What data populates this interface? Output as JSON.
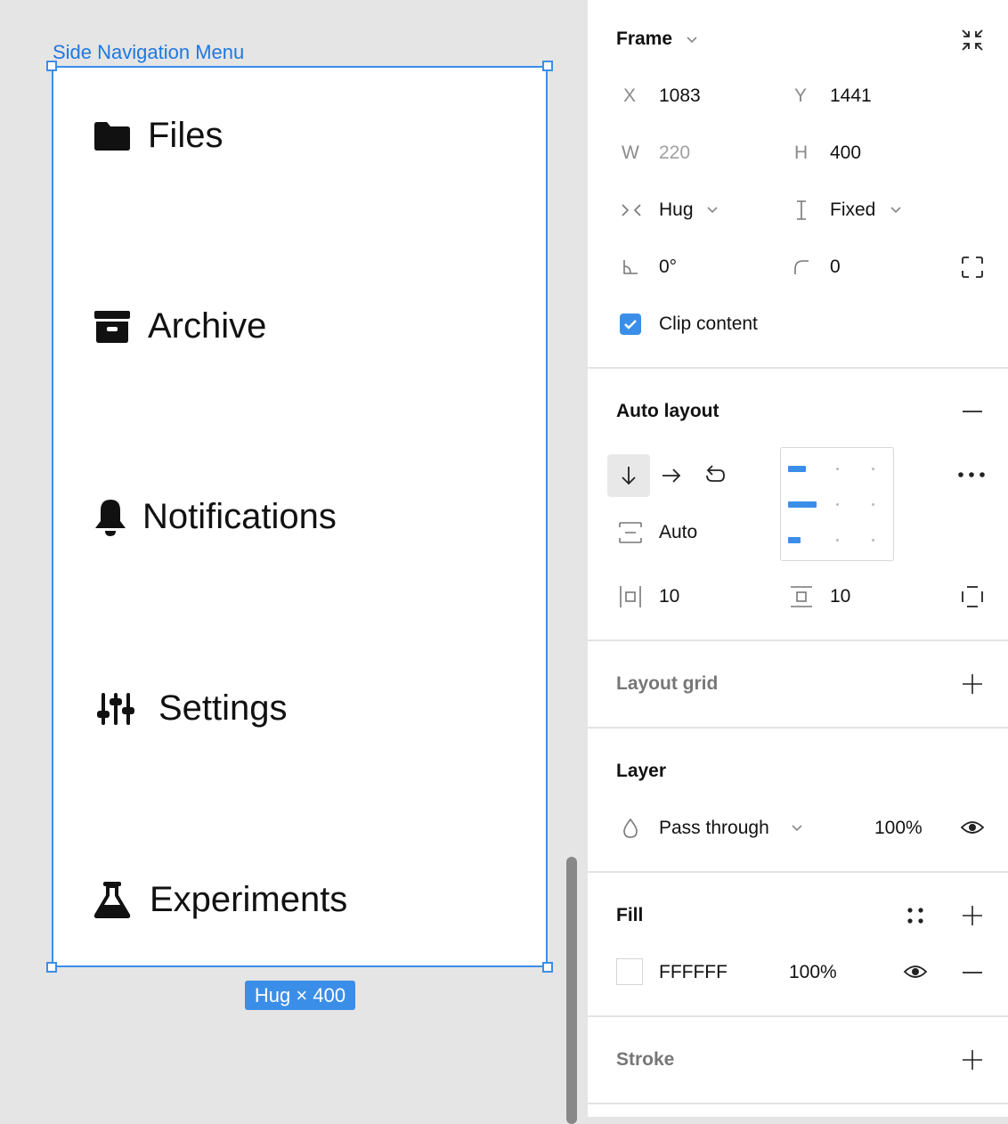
{
  "canvas": {
    "frame_label": "Side Navigation Menu",
    "size_badge": "Hug × 400",
    "nav_items": [
      {
        "label": "Files",
        "icon": "folder-icon"
      },
      {
        "label": "Archive",
        "icon": "archive-box-icon"
      },
      {
        "label": "Notifications",
        "icon": "bell-icon"
      },
      {
        "label": "Settings",
        "icon": "sliders-icon"
      },
      {
        "label": "Experiments",
        "icon": "flask-icon"
      }
    ]
  },
  "panel": {
    "frame": {
      "title": "Frame",
      "x_label": "X",
      "x_value": "1083",
      "y_label": "Y",
      "y_value": "1441",
      "w_label": "W",
      "w_value": "220",
      "h_label": "H",
      "h_value": "400",
      "width_mode": "Hug",
      "height_mode": "Fixed",
      "rotation": "0°",
      "radius": "0",
      "clip_content_label": "Clip content",
      "clip_content_checked": true
    },
    "auto_layout": {
      "title": "Auto layout",
      "spacing": "Auto",
      "h_padding": "10",
      "v_padding": "10"
    },
    "layout_grid": {
      "title": "Layout grid"
    },
    "layer": {
      "title": "Layer",
      "blend_mode": "Pass through",
      "opacity": "100%"
    },
    "fill": {
      "title": "Fill",
      "color_hex": "FFFFFF",
      "opacity": "100%"
    },
    "stroke": {
      "title": "Stroke"
    }
  },
  "colors": {
    "accent": "#3b8ee8",
    "label_blue": "#1e78e0"
  }
}
